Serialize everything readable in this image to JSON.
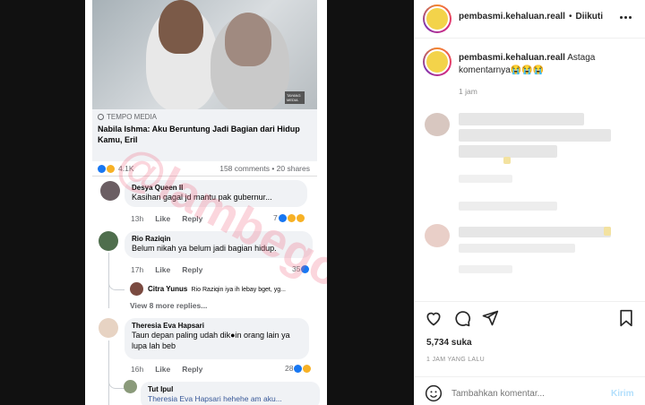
{
  "post_image": {
    "source_label": "TEMPO MEDIA",
    "photo_badge": "TAYANG MEDIA",
    "headline": "Nabila Ishma: Aku Beruntung Jadi Bagian dari Hidup Kamu, Eril",
    "reaction_count": "4.1K",
    "stats": "158 comments • 20 shares",
    "watermark": "@lambegosip",
    "comments": [
      {
        "name": "Desya Queen II",
        "text": "Kasihan gagal jd mantu pak gubernur...",
        "time": "13h",
        "like": "Like",
        "reply": "Reply",
        "reactions": "7"
      },
      {
        "name": "Rio Raziqin",
        "text": "Belum nikah ya belum jadi bagian hidup.",
        "time": "17h",
        "like": "Like",
        "reply": "Reply",
        "reactions": "35"
      },
      {
        "name": "Theresia Eva Hapsari",
        "text": "Taun depan paling udah dik●in orang lain ya lupa lah beb",
        "time": "16h",
        "like": "Like",
        "reply": "Reply",
        "reactions": "28"
      }
    ],
    "reply_preview": {
      "name": "Citra Yunus",
      "text": "Rio Raziqin iya ih lebay bget, yg..."
    },
    "view_more": "View 8 more replies...",
    "nested_reply": {
      "name": "Tut Ipul",
      "text": "Theresia Eva Hapsari hehehe am aku..."
    }
  },
  "sidebar": {
    "header": {
      "username": "pembasmi.kehaluan.reall",
      "separator": "•",
      "follow_status": "Diikuti",
      "more_icon": "more-icon"
    },
    "caption": {
      "username": "pembasmi.kehaluan.reall",
      "text": "Astaga komentarnya😭😭😭",
      "time": "1 jam"
    },
    "likes": "5,734 suka",
    "timestamp": "1 JAM YANG LALU",
    "comment_box": {
      "placeholder": "Tambahkan komentar...",
      "submit": "Kirim"
    },
    "colors": {
      "accent": "#0095f6",
      "like_blue": "#1877f2"
    }
  }
}
